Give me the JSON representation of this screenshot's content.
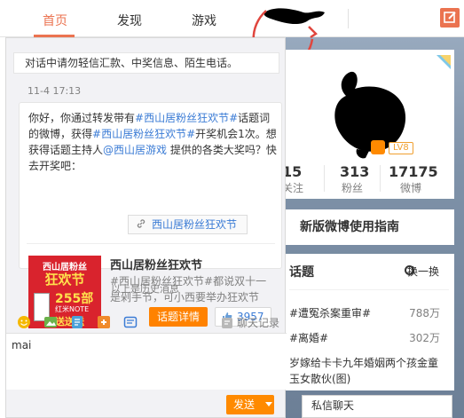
{
  "nav": {
    "items": [
      "首页",
      "发现",
      "游戏"
    ],
    "active": 0
  },
  "chat": {
    "warning": "对话中请勿轻信汇款、中奖信息、陌生电话。",
    "timestamp": "11-4 17:13",
    "message_part1": "你好，你通过转发带有",
    "message_topic1": "#西山居粉丝狂欢节#",
    "message_part2": "话题词的微博，获得",
    "message_topic2": "#西山居粉丝狂欢节#",
    "message_part3": "开奖机会1次。想获得话题主持人",
    "message_at": "@西山居游戏",
    "message_part4": " 提供的各类大奖吗？快去开奖吧：",
    "topic_link": "西山居粉丝狂欢节",
    "card_title": "西山居粉丝狂欢节",
    "card_desc": "#西山居粉丝狂欢节#都说双十一是剁手节，可小西要举办狂欢节",
    "card_img_top": "西山居粉丝",
    "card_img_mid": "狂欢节",
    "card_img_num": "255部",
    "card_img_sub": "红米NOTE",
    "card_img_bottom": "送送送",
    "detail_button": "话题详情",
    "like_count": "3957",
    "history_label": "以上是历史消息",
    "chat_log_label": "聊天记录",
    "input_value": "mai",
    "send_label": "发送"
  },
  "profile": {
    "level": "LV8",
    "stats": [
      {
        "num": "15",
        "label": "关注"
      },
      {
        "num": "313",
        "label": "粉丝"
      },
      {
        "num": "17175",
        "label": "微博"
      }
    ]
  },
  "guide": {
    "title": "新版微博使用指南"
  },
  "topics": {
    "title": "话题",
    "refresh": "换一换",
    "items": [
      {
        "text": "#遭冤杀案重审#",
        "count": "788万"
      },
      {
        "text": "#离婚#",
        "count": "302万"
      },
      {
        "text": "岁嫁给卡卡九年婚姻两个孩金童玉女散伙(图)",
        "count": ""
      }
    ]
  },
  "private_chat": {
    "label": "私信聊天"
  },
  "colors": {
    "accent": "#eb7350",
    "orange": "#ff8200",
    "link": "#3a7bd5"
  }
}
